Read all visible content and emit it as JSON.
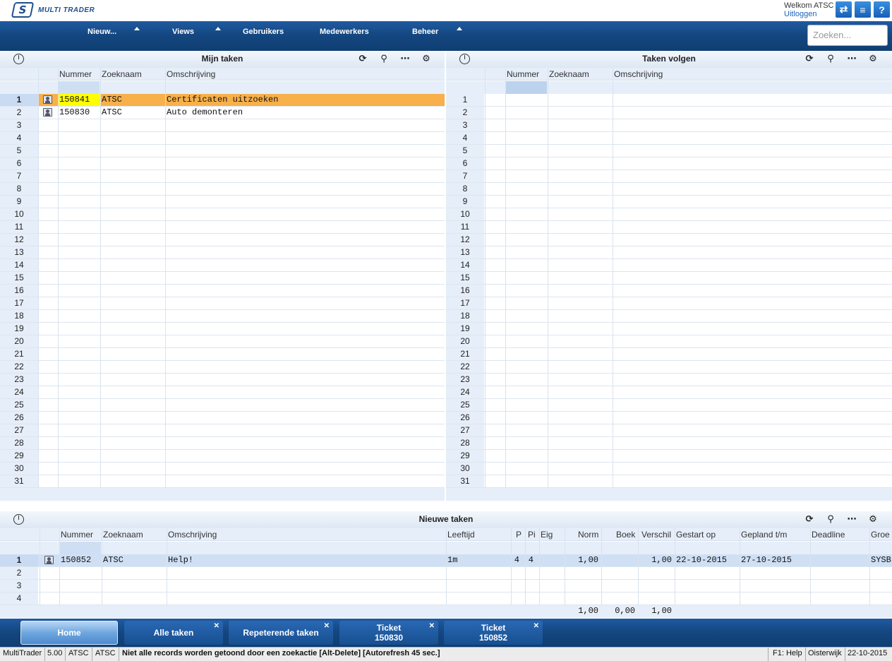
{
  "app": {
    "logo_mark": "S",
    "logo_text": "MULTI TRADER",
    "welcome": "Welkom ATSC",
    "logout": "Uitloggen"
  },
  "topicons": [
    "switch-icon",
    "list-icon",
    "help-icon"
  ],
  "nav": {
    "items": [
      "Nieuw...",
      "Views",
      "Gebruikers",
      "Medewerkers",
      "Beheer"
    ],
    "search_placeholder": "Zoeken..."
  },
  "mijn_taken": {
    "title": "Mijn taken",
    "columns": [
      "Nummer",
      "Zoeknaam",
      "Omschrijving"
    ],
    "rows": [
      {
        "nummer": "150841",
        "zoeknaam": "ATSC",
        "omschrijving": "Certificaten uitzoeken"
      },
      {
        "nummer": "150830",
        "zoeknaam": "ATSC",
        "omschrijving": "Auto demonteren"
      }
    ],
    "row_count": 31
  },
  "taken_volgen": {
    "title": "Taken volgen",
    "columns": [
      "Nummer",
      "Zoeknaam",
      "Omschrijving"
    ],
    "rows": [],
    "row_count": 31
  },
  "nieuwe_taken": {
    "title": "Nieuwe taken",
    "columns": [
      "Nummer",
      "Zoeknaam",
      "Omschrijving",
      "Leeftijd",
      "P",
      "Pi",
      "Eig",
      "Norm",
      "Boek",
      "Verschil",
      "Gestart op",
      "Gepland t/m",
      "Deadline",
      "Groe"
    ],
    "rows": [
      {
        "nummer": "150852",
        "zoeknaam": "ATSC",
        "omschrijving": "Help!",
        "leeftijd": "1m",
        "p": "4",
        "pi": "4",
        "eig": "",
        "norm": "1,00",
        "boek": "",
        "verschil": "1,00",
        "gestart": "22-10-2015",
        "gepland": "27-10-2015",
        "deadline": "",
        "groep": "SYSB"
      }
    ],
    "row_count": 4,
    "totals": {
      "norm": "1,00",
      "boek": "0,00",
      "verschil": "1,00"
    }
  },
  "tabs": [
    {
      "label": "Home",
      "sub": "",
      "closable": false,
      "active": true
    },
    {
      "label": "Alle taken",
      "sub": "",
      "closable": true,
      "active": false
    },
    {
      "label": "Repeterende taken",
      "sub": "",
      "closable": true,
      "active": false
    },
    {
      "label": "Ticket",
      "sub": "150830",
      "closable": true,
      "active": false
    },
    {
      "label": "Ticket",
      "sub": "150852",
      "closable": true,
      "active": false
    }
  ],
  "status": {
    "app": "MultiTrader",
    "version": "5.00",
    "user": "ATSC",
    "company": "ATSC",
    "message": "Niet alle records worden getoond door een zoekactie [Alt-Delete] [Autorefresh 45 sec.]",
    "help": "F1: Help",
    "location": "Oisterwijk",
    "date": "22-10-2015"
  },
  "colors": {
    "nav": "#14467f",
    "selected_row": "#f7b04a",
    "selected_cell": "#ffff00",
    "grid_header": "#e6eef9",
    "selected_row_blue": "#cfe0f5"
  }
}
